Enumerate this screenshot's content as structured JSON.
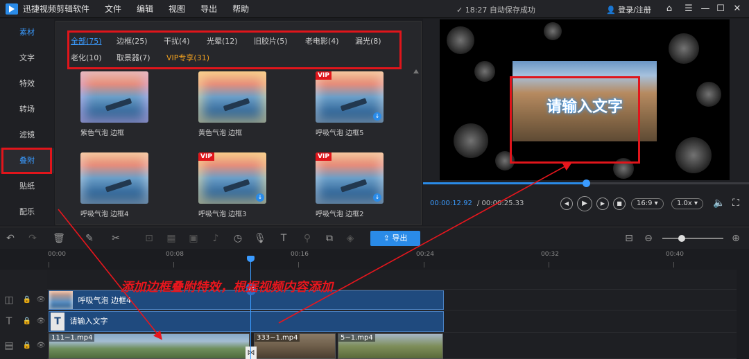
{
  "titlebar": {
    "app_title": "迅捷视频剪辑软件",
    "menus": [
      "文件",
      "编辑",
      "视图",
      "导出",
      "帮助"
    ],
    "save_status": "✓ 18:27 自动保存成功",
    "login": "登录/注册"
  },
  "left_nav": {
    "items": [
      "素材",
      "文字",
      "特效",
      "转场",
      "滤镜",
      "叠附",
      "贴纸",
      "配乐"
    ],
    "active": "叠附",
    "active_color": "#3a9bff"
  },
  "library": {
    "tabs_row1": [
      "全部(75)",
      "边框(25)",
      "干扰(4)",
      "光晕(12)",
      "旧胶片(5)",
      "老电影(4)",
      "漏光(8)"
    ],
    "tabs_row2": [
      "老化(10)",
      "取景器(7)",
      "VIP专享(31)"
    ],
    "items": [
      {
        "label": "紫色气泡 边框",
        "vip": false
      },
      {
        "label": "黄色气泡 边框",
        "vip": false
      },
      {
        "label": "呼吸气泡 边框5",
        "vip": true
      },
      {
        "label": "呼吸气泡 边框4",
        "vip": false
      },
      {
        "label": "呼吸气泡 边框3",
        "vip": true
      },
      {
        "label": "呼吸气泡 边框2",
        "vip": true
      }
    ],
    "vip_badge": "VIP",
    "vip_tab_color": "#f0a020"
  },
  "preview": {
    "overlay_text": "请输入文字",
    "time_current": "00:00:12.92",
    "time_total": "/ 00:00:25.33",
    "progress": 0.5,
    "aspect": "16:9",
    "speed": "1.0x"
  },
  "toolbar": {
    "export_label": "导出"
  },
  "timeline": {
    "ticks": [
      "00:00",
      "00:08",
      "00:16",
      "00:24",
      "00:32",
      "00:40"
    ],
    "tracks": {
      "overlay_clip": "呼吸气泡 边框4",
      "text_clip": "请输入文字",
      "video_clips": [
        "111~1.mp4",
        "333~1.mp4",
        "5~1.mp4"
      ]
    },
    "annotation": "添加边框叠附特效，根据视频内容添加",
    "accent": "#2a8be8",
    "annotation_color": "#e8161d"
  }
}
